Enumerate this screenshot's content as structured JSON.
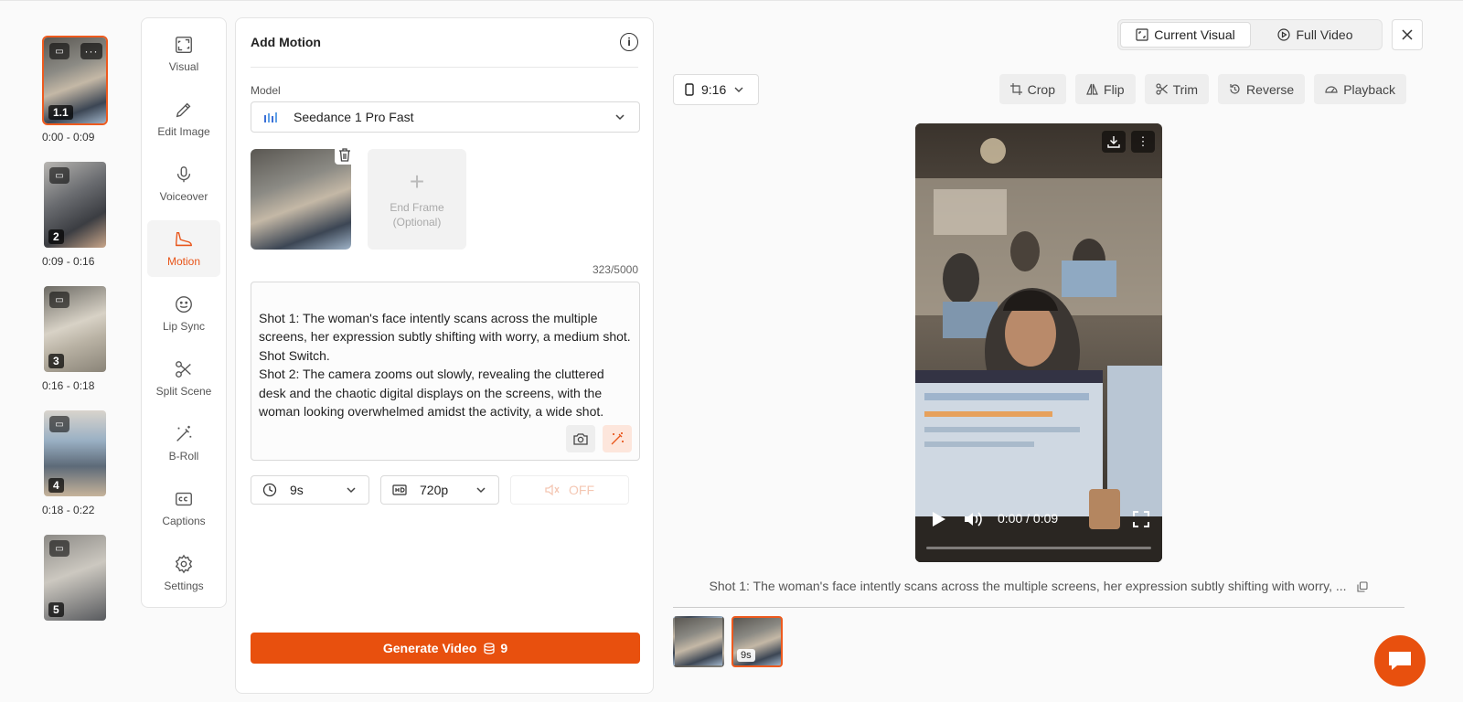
{
  "scenes": [
    {
      "num": "1.1",
      "time": "0:00 - 0:09",
      "active": true
    },
    {
      "num": "2",
      "time": "0:09 - 0:16"
    },
    {
      "num": "3",
      "time": "0:16 - 0:18"
    },
    {
      "num": "4",
      "time": "0:18 - 0:22"
    },
    {
      "num": "5",
      "time": ""
    }
  ],
  "tools": [
    {
      "label": "Visual",
      "icon": "expand-icon"
    },
    {
      "label": "Edit Image",
      "icon": "pencil-icon"
    },
    {
      "label": "Voiceover",
      "icon": "microphone-icon"
    },
    {
      "label": "Motion",
      "icon": "shoe-icon",
      "active": true
    },
    {
      "label": "Lip Sync",
      "icon": "smiley-icon"
    },
    {
      "label": "Split Scene",
      "icon": "scissors-icon"
    },
    {
      "label": "B-Roll",
      "icon": "magic-wand-icon"
    },
    {
      "label": "Captions",
      "icon": "cc-icon"
    },
    {
      "label": "Settings",
      "icon": "gear-icon"
    }
  ],
  "panel": {
    "title": "Add Motion",
    "model_label": "Model",
    "model_value": "Seedance 1 Pro Fast",
    "end_frame_label": "End Frame",
    "end_frame_hint": "(Optional)",
    "char_count": "323/5000",
    "prompt": "Shot 1: The woman's face intently scans across the multiple screens, her expression subtly shifting with worry, a medium shot.\nShot Switch.\nShot 2: The camera zooms out slowly, revealing the cluttered desk and the chaotic digital displays on the screens, with the woman looking overwhelmed amidst the activity, a wide shot.",
    "duration": "9s",
    "resolution": "720p",
    "audio": "OFF",
    "generate_label": "Generate Video",
    "generate_cost": "9"
  },
  "preview": {
    "current_visual": "Current Visual",
    "full_video": "Full Video",
    "ratio": "9:16",
    "edit_tools": [
      "Crop",
      "Flip",
      "Trim",
      "Reverse",
      "Playback"
    ],
    "time_display": "0:00 / 0:09",
    "caption": "Shot 1: The woman's face intently scans across the multiple screens, her expression subtly shifting with worry, ...",
    "clip_duration": "9s"
  },
  "colors": {
    "accent": "#e8500e"
  }
}
